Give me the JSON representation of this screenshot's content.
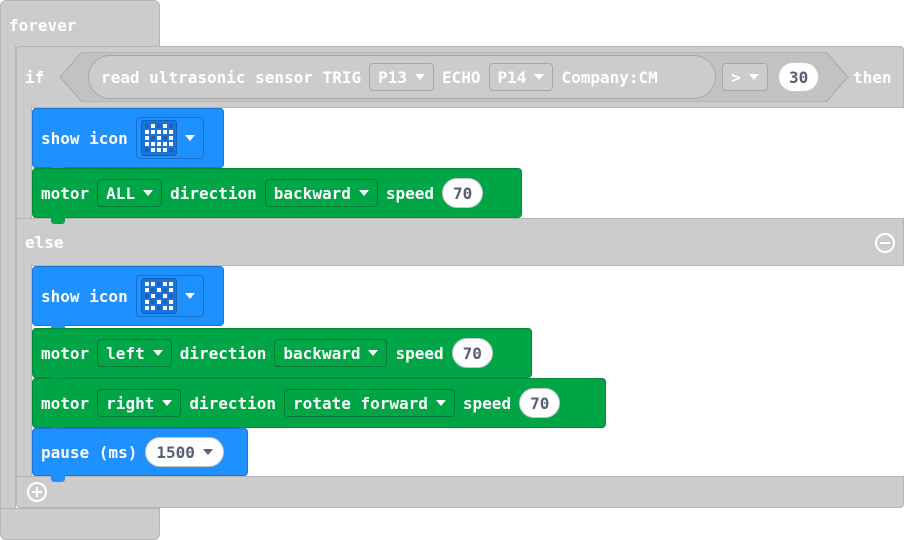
{
  "forever_label": "forever",
  "if_label": "if",
  "then_label": "then",
  "else_label": "else",
  "condition": {
    "reader_label": "read ultrasonic sensor TRIG",
    "trig_pin": "P13",
    "echo_label": "ECHO",
    "echo_pin": "P14",
    "unit_label": "Company:CM",
    "operator": ">",
    "threshold": "30"
  },
  "then_blocks": {
    "icon_label": "show icon",
    "icon_pattern": [
      0,
      1,
      0,
      1,
      0,
      1,
      1,
      1,
      1,
      1,
      1,
      0,
      1,
      0,
      1,
      1,
      1,
      1,
      1,
      1,
      0,
      1,
      1,
      1,
      0
    ],
    "motor": {
      "label": "motor",
      "target": "ALL",
      "direction_label": "direction",
      "direction": "backward",
      "speed_label": "speed",
      "speed": "70"
    }
  },
  "else_blocks": {
    "icon_label": "show icon",
    "icon_pattern": [
      1,
      1,
      0,
      1,
      1,
      1,
      0,
      1,
      0,
      1,
      0,
      1,
      0,
      1,
      0,
      1,
      0,
      1,
      0,
      1,
      1,
      1,
      0,
      1,
      1
    ],
    "motor_left": {
      "label": "motor",
      "target": "left",
      "direction_label": "direction",
      "direction": "backward",
      "speed_label": "speed",
      "speed": "70"
    },
    "motor_right": {
      "label": "motor",
      "target": "right",
      "direction_label": "direction",
      "direction": "rotate forward",
      "speed_label": "speed",
      "speed": "70"
    },
    "pause": {
      "label": "pause (ms)",
      "value": "1500"
    }
  },
  "colors": {
    "control": "#cccccc",
    "basic": "#1e90ff",
    "motor": "#00a546"
  }
}
